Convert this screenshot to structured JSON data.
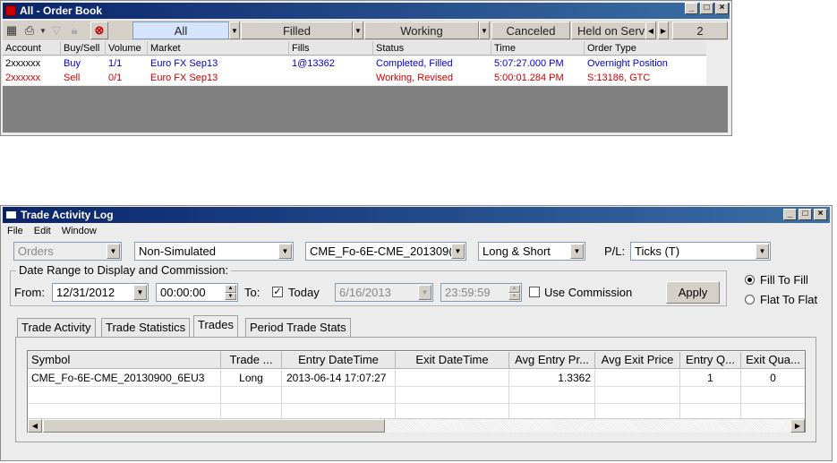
{
  "order_book": {
    "title": "All - Order Book",
    "filters": [
      "All",
      "Filled",
      "Working",
      "Canceled",
      "Held on Serv"
    ],
    "page_count": "2",
    "columns": [
      "Account",
      "Buy/Sell",
      "Volume",
      "Market",
      "Fills",
      "Status",
      "Time",
      "Order Type"
    ],
    "rows": [
      {
        "account": "2xxxxxx",
        "side": "Buy",
        "volume": "1/1",
        "market": "Euro FX Sep13",
        "fills": "1@13362",
        "status": "Completed, Filled",
        "time": "5:07:27.000 PM",
        "order_type": "Overnight Position",
        "color": "#0000cc"
      },
      {
        "account": "2xxxxxx",
        "side": "Sell",
        "volume": "0/1",
        "market": "Euro FX Sep13",
        "fills": "",
        "status": "Working, Revised",
        "time": "5:00:01.284 PM",
        "order_type": "S:13186, GTC",
        "color": "#cc0000"
      }
    ]
  },
  "trade_log": {
    "title": "Trade Activity Log",
    "menu": [
      "File",
      "Edit",
      "Window"
    ],
    "orders_combo": "Orders",
    "sim_combo": "Non-Simulated",
    "symbol_combo": "CME_Fo-6E-CME_201309(",
    "direction_combo": "Long & Short",
    "pl_label": "P/L:",
    "pl_combo": "Ticks (T)",
    "date_group_label": "Date Range to Display and Commission:",
    "from_label": "From:",
    "from_date": "12/31/2012",
    "from_time": "00:00:00",
    "to_label": "To:",
    "today_label": "Today",
    "to_date": "6/16/2013",
    "to_time": "23:59:59",
    "use_commission_label": "Use Commission",
    "apply_label": "Apply",
    "fill_to_fill": "Fill To Fill",
    "flat_to_flat": "Flat To Flat",
    "tabs": [
      "Trade Activity",
      "Trade Statistics",
      "Trades",
      "Period Trade Stats"
    ],
    "grid_columns": [
      "Symbol",
      "Trade ...",
      "Entry DateTime",
      "Exit DateTime",
      "Avg Entry Pr...",
      "Avg Exit Price",
      "Entry Q...",
      "Exit Qua..."
    ],
    "grid_rows": [
      {
        "symbol": "CME_Fo-6E-CME_20130900_6EU3",
        "trade": "Long",
        "entry_dt": "2013-06-14 17:07:27",
        "exit_dt": "",
        "avg_entry": "1.3362",
        "avg_exit": "",
        "entry_qty": "1",
        "exit_qty": "0"
      }
    ]
  },
  "colors": {
    "title_bar": "#0a246a",
    "buy": "#0000cc",
    "sell": "#cc0000",
    "active_filter": "#d6e4fb"
  }
}
